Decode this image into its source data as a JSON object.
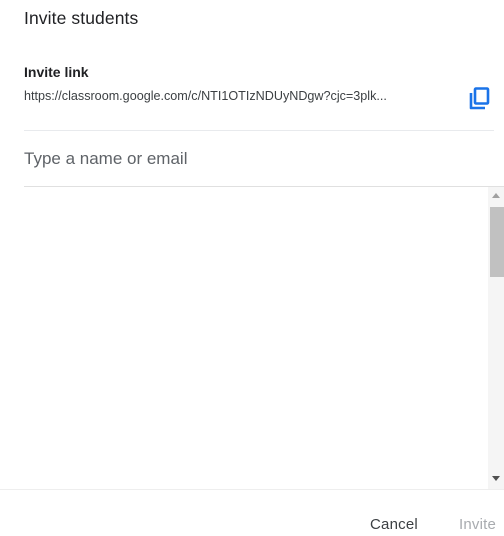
{
  "dialog": {
    "title": "Invite students",
    "invite_link": {
      "label": "Invite link",
      "url": "https://classroom.google.com/c/NTI1OTIzNDUyNDgw?cjc=3plk...",
      "copy_icon": "copy-icon",
      "accent_color": "#1a73e8"
    },
    "search": {
      "placeholder": "Type a name or email",
      "value": ""
    },
    "footer": {
      "cancel_label": "Cancel",
      "invite_label": "Invite",
      "invite_disabled": true
    }
  }
}
